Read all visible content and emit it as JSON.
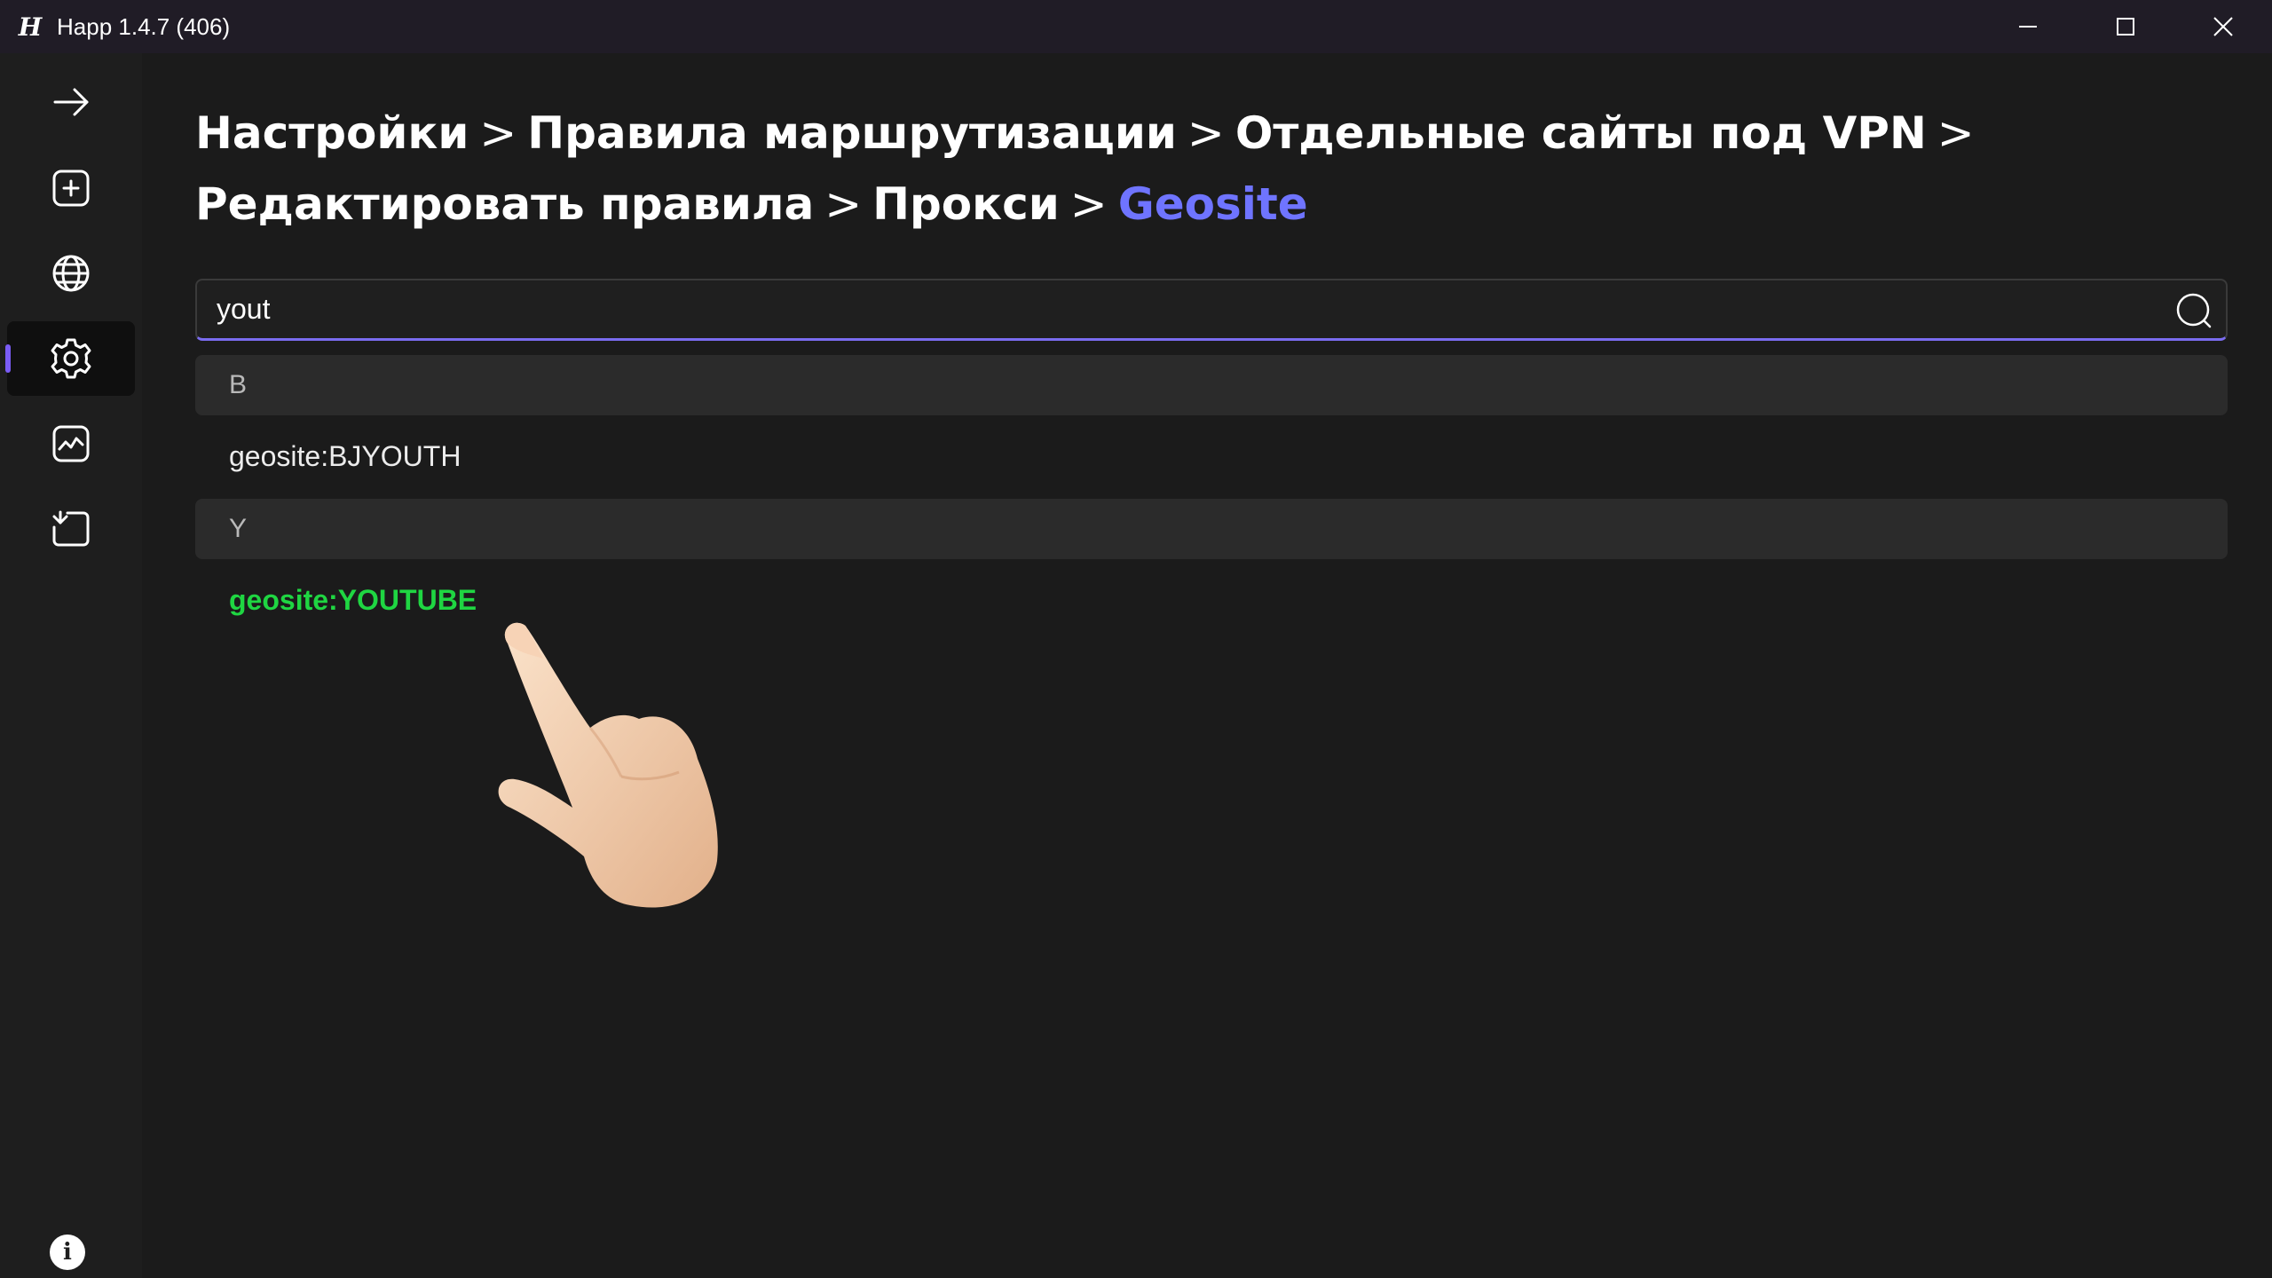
{
  "window": {
    "logo_glyph": "H",
    "title": "Happ 1.4.7 (406)"
  },
  "sidebar": {
    "items": [
      {
        "name": "arrow-right-icon"
      },
      {
        "name": "add-profile-icon"
      },
      {
        "name": "globe-icon"
      },
      {
        "name": "gear-icon",
        "active": true
      },
      {
        "name": "activity-chart-icon"
      },
      {
        "name": "import-icon"
      }
    ],
    "info_glyph": "i"
  },
  "breadcrumb": {
    "items": [
      "Настройки",
      "Правила маршрутизации",
      "Отдельные сайты под VPN",
      "Редактировать правила",
      "Прокси"
    ],
    "separator": ">",
    "current": "Geosite"
  },
  "search": {
    "value": "yout",
    "placeholder": ""
  },
  "groups": [
    {
      "header": "B",
      "items": [
        "geosite:BJYOUTH"
      ]
    },
    {
      "header": "Y",
      "items": [
        "geosite:YOUTUBE"
      ]
    }
  ],
  "colors": {
    "accent": "#7a5cf5",
    "breadcrumb_current": "#6f74ff",
    "selected_item": "#1fd642"
  }
}
